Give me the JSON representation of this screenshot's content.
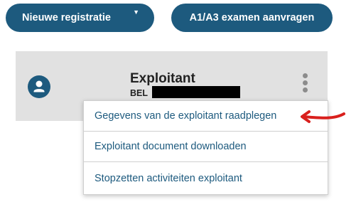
{
  "toolbar": {
    "new_registration_label": "Nieuwe registratie",
    "exam_request_label": "A1/A3 examen aanvragen"
  },
  "card": {
    "title": "Exploitant",
    "id_prefix": "BEL"
  },
  "menu": {
    "items": [
      "Gegevens van de exploitant raadplegen",
      "Exploitant document downloaden",
      "Stopzetten activiteiten exploitant"
    ]
  },
  "colors": {
    "primary": "#1d5a7e",
    "card_bg": "#e1e1e1",
    "arrow": "#d9201d"
  },
  "icons": {
    "avatar": "person-icon",
    "dropdown": "caret-down-icon",
    "more": "kebab-menu-icon",
    "annotation": "red-arrow-icon"
  }
}
